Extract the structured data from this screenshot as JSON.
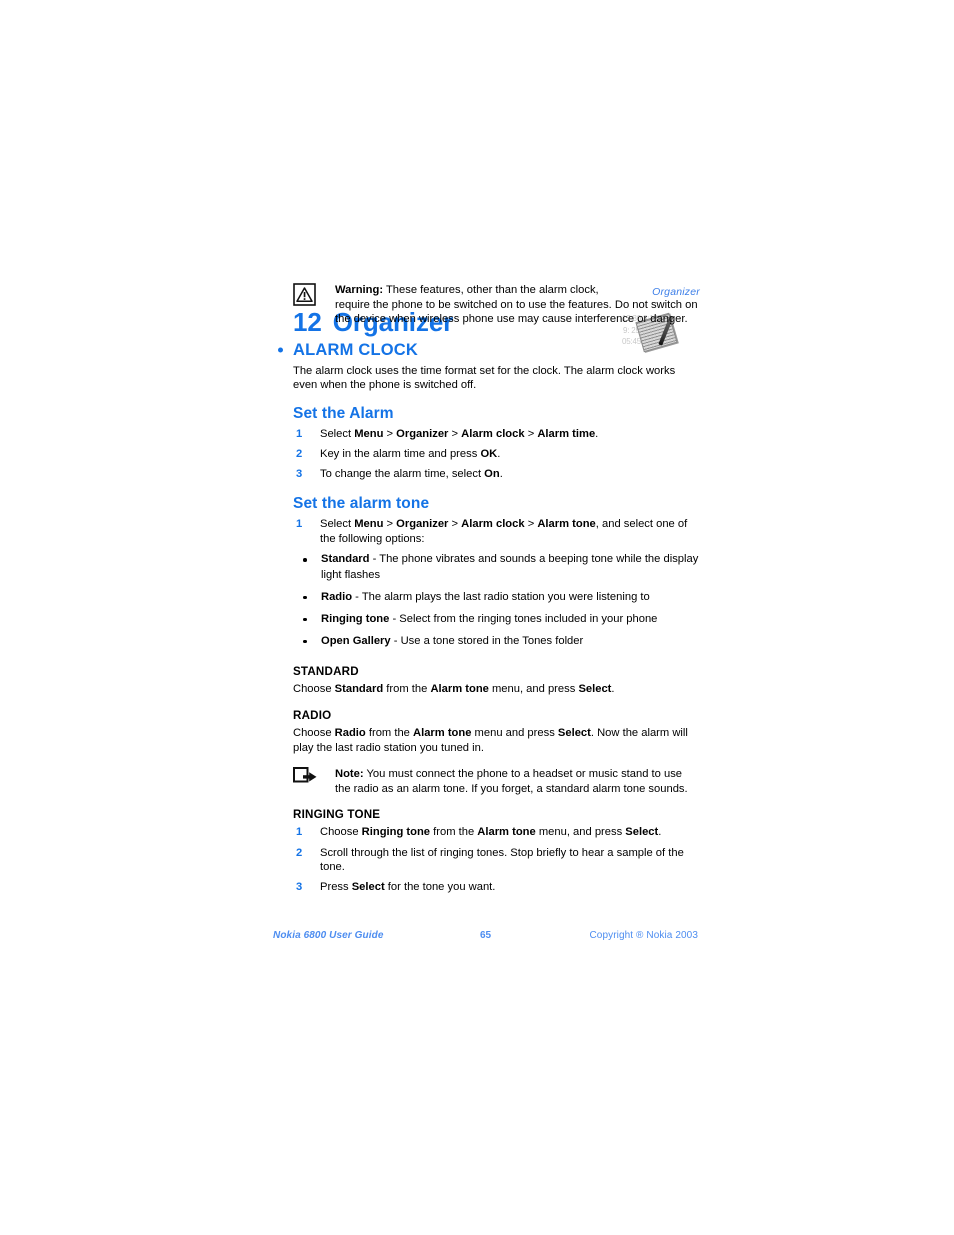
{
  "page": {
    "running_header": "Organizer",
    "chapter_number": "12",
    "chapter_title": "Organizer",
    "graphic": {
      "line1": "12:30    8:15am",
      "line2": "9:           25.7",
      "line3": "05:45    6: pm",
      "icon": "notepad-and-pen"
    }
  },
  "warning": {
    "label": "Warning:",
    "text_line1": " These features, other than the alarm clock,",
    "text_line2": "require the phone to be switched on to use the features. Do not switch on",
    "text_line3": "the device when wireless phone use may cause interference or danger.",
    "icon": "warning-triangle-icon"
  },
  "alarm_clock": {
    "heading": "ALARM CLOCK",
    "intro": "The alarm clock uses the time format set for the clock. The alarm clock works even when the phone is switched off."
  },
  "set_the_alarm": {
    "heading": "Set the Alarm",
    "steps": [
      {
        "num": "1",
        "parts": [
          {
            "t": "Select ",
            "b": false
          },
          {
            "t": "Menu",
            "b": true
          },
          {
            "t": " > ",
            "b": false
          },
          {
            "t": "Organizer",
            "b": true
          },
          {
            "t": " > ",
            "b": false
          },
          {
            "t": "Alarm clock",
            "b": true
          },
          {
            "t": " > ",
            "b": false
          },
          {
            "t": "Alarm time",
            "b": true
          },
          {
            "t": ".",
            "b": false
          }
        ]
      },
      {
        "num": "2",
        "parts": [
          {
            "t": "Key in the alarm time and press ",
            "b": false
          },
          {
            "t": "OK",
            "b": true
          },
          {
            "t": ".",
            "b": false
          }
        ]
      },
      {
        "num": "3",
        "parts": [
          {
            "t": "To change the alarm time, select ",
            "b": false
          },
          {
            "t": "On",
            "b": true
          },
          {
            "t": ".",
            "b": false
          }
        ]
      }
    ]
  },
  "set_the_alarm_tone": {
    "heading": "Set the alarm tone",
    "steps": [
      {
        "num": "1",
        "parts": [
          {
            "t": "Select ",
            "b": false
          },
          {
            "t": "Menu",
            "b": true
          },
          {
            "t": " > ",
            "b": false
          },
          {
            "t": "Organizer",
            "b": true
          },
          {
            "t": " > ",
            "b": false
          },
          {
            "t": "Alarm clock",
            "b": true
          },
          {
            "t": " > ",
            "b": false
          },
          {
            "t": "Alarm tone",
            "b": true
          },
          {
            "t": ", and select one of the following options:",
            "b": false
          }
        ]
      }
    ],
    "options": [
      {
        "parts": [
          {
            "t": "Standard",
            "b": true
          },
          {
            "t": " - The phone vibrates and sounds a beeping tone while the display light flashes",
            "b": false
          }
        ]
      },
      {
        "parts": [
          {
            "t": "Radio",
            "b": true
          },
          {
            "t": " - The alarm plays the last radio station you were listening to",
            "b": false
          }
        ]
      },
      {
        "parts": [
          {
            "t": "Ringing tone",
            "b": true
          },
          {
            "t": " - Select from the ringing tones included in your phone",
            "b": false
          }
        ]
      },
      {
        "parts": [
          {
            "t": "Open Gallery",
            "b": true
          },
          {
            "t": " - Use a tone stored in the Tones folder",
            "b": false
          }
        ]
      }
    ]
  },
  "standard": {
    "heading": "STANDARD",
    "parts": [
      {
        "t": "Choose ",
        "b": false
      },
      {
        "t": "Standard",
        "b": true
      },
      {
        "t": " from the ",
        "b": false
      },
      {
        "t": "Alarm tone",
        "b": true
      },
      {
        "t": " menu, and press ",
        "b": false
      },
      {
        "t": "Select",
        "b": true
      },
      {
        "t": ".",
        "b": false
      }
    ]
  },
  "radio": {
    "heading": "RADIO",
    "parts": [
      {
        "t": "Choose ",
        "b": false
      },
      {
        "t": "Radio",
        "b": true
      },
      {
        "t": " from the ",
        "b": false
      },
      {
        "t": "Alarm tone",
        "b": true
      },
      {
        "t": " menu and press ",
        "b": false
      },
      {
        "t": "Select",
        "b": true
      },
      {
        "t": ". Now the alarm will play the last radio station you tuned in.",
        "b": false
      }
    ]
  },
  "note": {
    "label": "Note:",
    "text": " You must connect the phone to a headset or music stand to use the radio as an alarm tone. If you forget, a standard alarm tone sounds.",
    "icon": "note-arrow-icon"
  },
  "ringing_tone": {
    "heading": "RINGING TONE",
    "steps": [
      {
        "num": "1",
        "parts": [
          {
            "t": "Choose ",
            "b": false
          },
          {
            "t": "Ringing tone",
            "b": true
          },
          {
            "t": " from the ",
            "b": false
          },
          {
            "t": "Alarm tone",
            "b": true
          },
          {
            "t": " menu, and press ",
            "b": false
          },
          {
            "t": "Select",
            "b": true
          },
          {
            "t": ".",
            "b": false
          }
        ]
      },
      {
        "num": "2",
        "parts": [
          {
            "t": "Scroll through the list of ringing tones. Stop briefly to hear a sample of the tone.",
            "b": false
          }
        ]
      },
      {
        "num": "3",
        "parts": [
          {
            "t": "Press ",
            "b": false
          },
          {
            "t": "Select",
            "b": true
          },
          {
            "t": " for the tone you want.",
            "b": false
          }
        ]
      }
    ]
  },
  "footer": {
    "left": "Nokia 6800 User Guide",
    "page_number": "65",
    "right": "Copyright ® Nokia 2003"
  },
  "colors": {
    "heading_blue": "#1473e6",
    "footer_blue": "#4d8df0",
    "body_black": "#000000"
  }
}
